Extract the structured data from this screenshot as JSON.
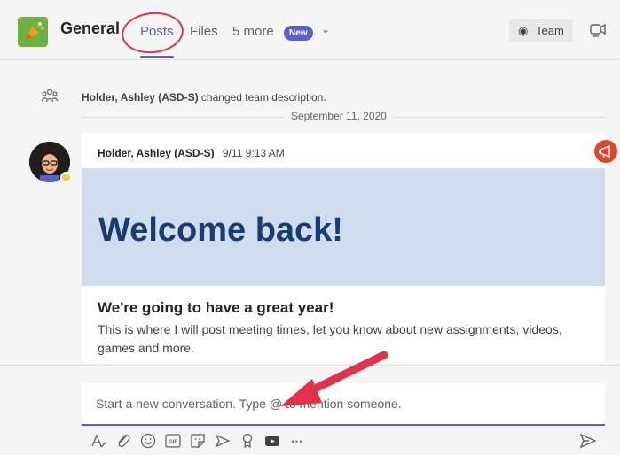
{
  "header": {
    "channel_name": "General",
    "tabs": [
      {
        "label": "Posts",
        "active": true
      },
      {
        "label": "Files",
        "active": false
      },
      {
        "label": "5 more",
        "active": false
      }
    ],
    "new_badge": "New",
    "team_button_label": "Team"
  },
  "activity": {
    "system_message_author": "Holder, Ashley (ASD-S)",
    "system_message_text": "changed team description.",
    "date_separator": "September 11, 2020"
  },
  "post": {
    "author": "Holder, Ashley (ASD-S)",
    "timestamp": "9/11 9:13 AM",
    "banner_text": "Welcome back!",
    "title": "We're going to have a great year!",
    "body": "This is where I will post meeting times, let you know about new assignments, videos, games and more."
  },
  "compose": {
    "placeholder": "Start a new conversation. Type @ to mention someone.",
    "tools": [
      "format-icon",
      "attach-icon",
      "emoji-icon",
      "gif-icon",
      "sticker-icon",
      "stream-icon",
      "praise-icon",
      "video-icon",
      "more-options-icon"
    ]
  },
  "colors": {
    "accent": "#5b5fc7",
    "annotation": "#e0334b",
    "banner_bg": "#cfddef",
    "banner_text": "#1a3c6e"
  }
}
